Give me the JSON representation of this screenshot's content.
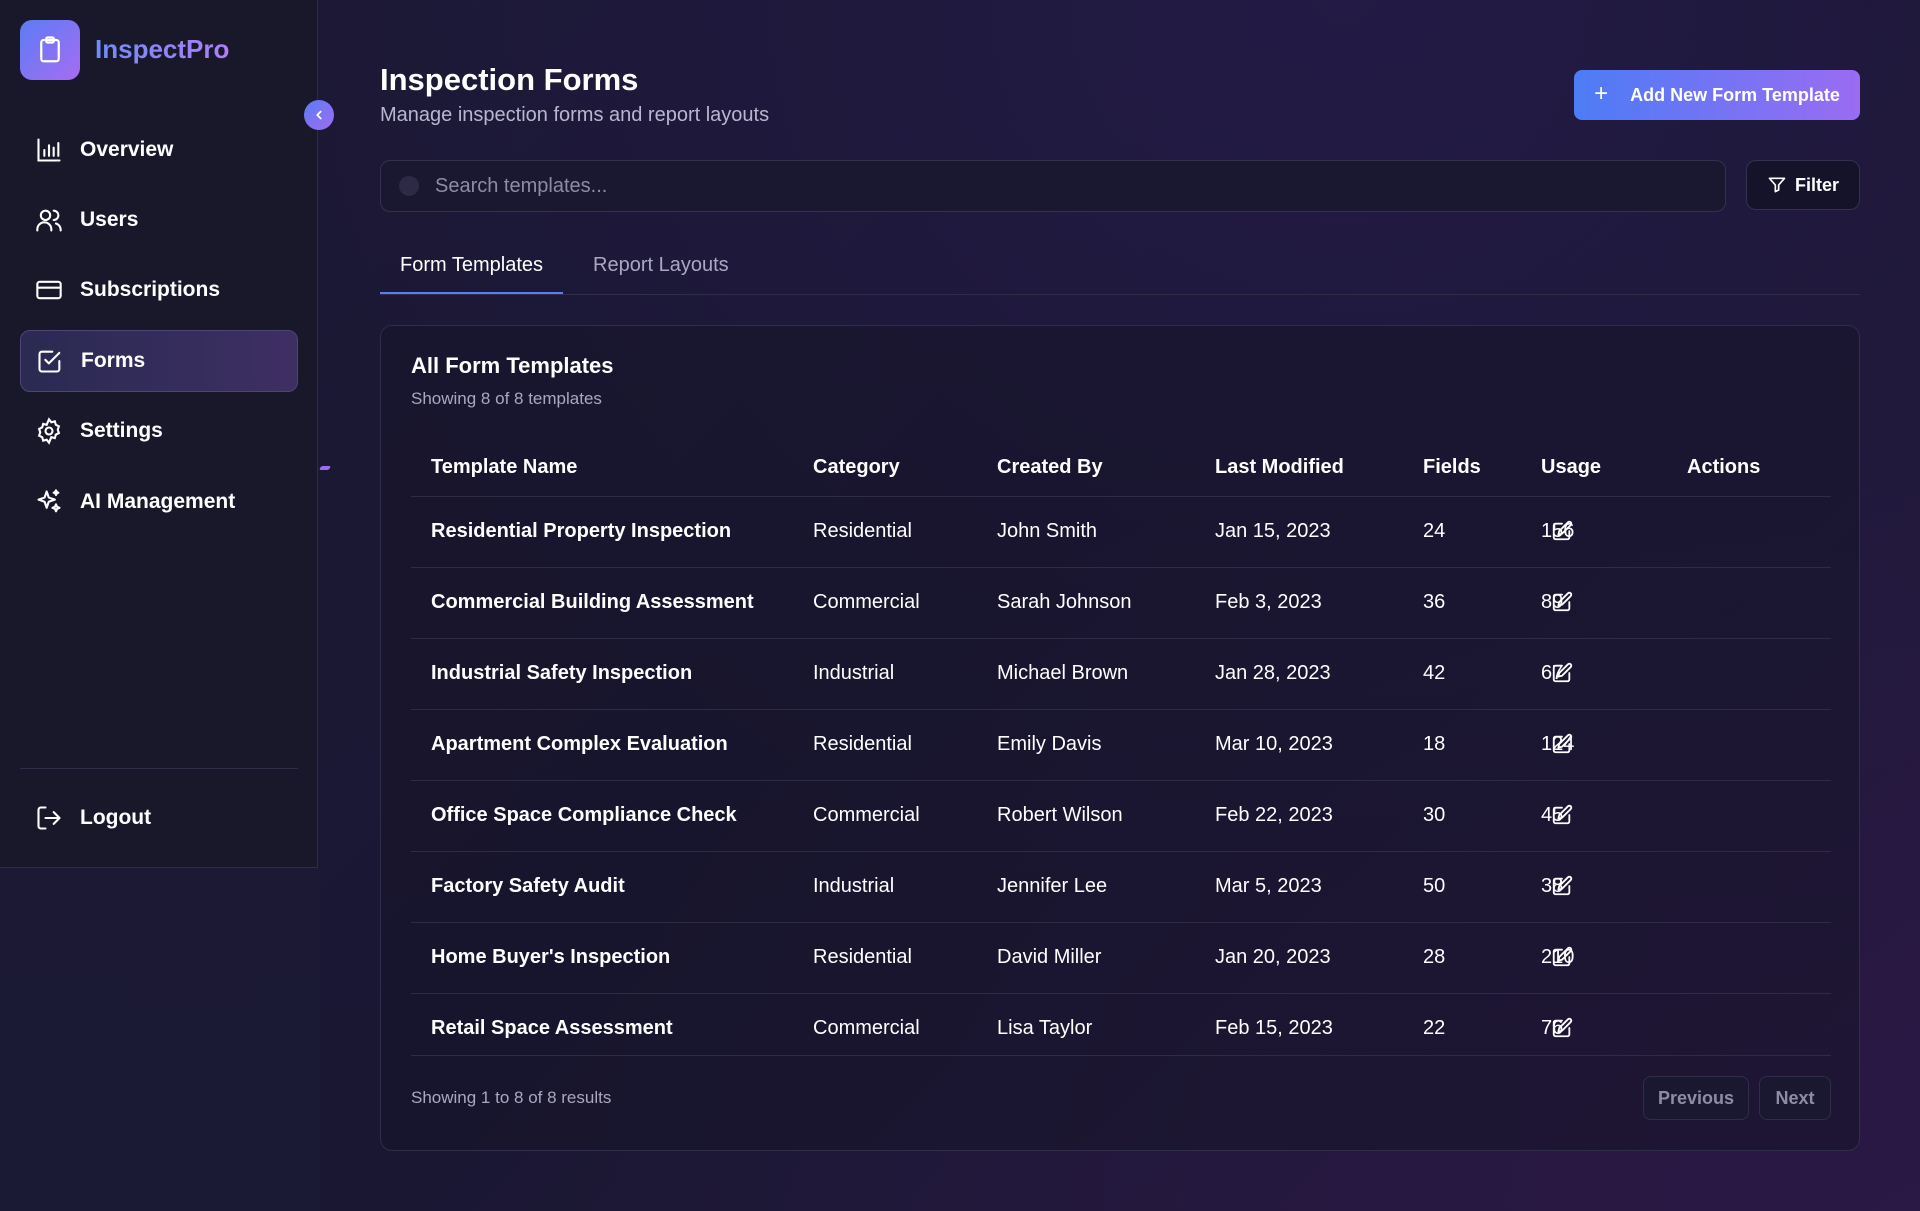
{
  "app": {
    "brand": "InspectPro"
  },
  "sidebar": {
    "items": [
      {
        "label": "Overview",
        "icon": "chart-bar-icon"
      },
      {
        "label": "Users",
        "icon": "users-icon"
      },
      {
        "label": "Subscriptions",
        "icon": "credit-card-icon"
      },
      {
        "label": "Forms",
        "icon": "clipboard-check-icon",
        "active": true
      },
      {
        "label": "Settings",
        "icon": "gear-icon"
      },
      {
        "label": "AI Management",
        "icon": "sparkles-icon"
      }
    ],
    "logout_label": "Logout"
  },
  "header": {
    "title": "Inspection Forms",
    "subtitle": "Manage inspection forms and report layouts",
    "add_button_label": "Add New Form Template"
  },
  "search": {
    "placeholder": "Search templates...",
    "value": ""
  },
  "filter_label": "Filter",
  "tabs": [
    {
      "label": "Form Templates",
      "active": true
    },
    {
      "label": "Report Layouts",
      "active": false
    }
  ],
  "card": {
    "title": "All Form Templates",
    "subtitle": "Showing 8 of 8 templates"
  },
  "table": {
    "columns": [
      "Template Name",
      "Category",
      "Created By",
      "Last Modified",
      "Fields",
      "Usage",
      "Actions"
    ],
    "rows": [
      {
        "name": "Residential Property Inspection",
        "category": "Residential",
        "created_by": "John Smith",
        "modified": "Jan 15, 2023",
        "fields": "24",
        "usage": "156"
      },
      {
        "name": "Commercial Building Assessment",
        "category": "Commercial",
        "created_by": "Sarah Johnson",
        "modified": "Feb 3, 2023",
        "fields": "36",
        "usage": "89"
      },
      {
        "name": "Industrial Safety Inspection",
        "category": "Industrial",
        "created_by": "Michael Brown",
        "modified": "Jan 28, 2023",
        "fields": "42",
        "usage": "67"
      },
      {
        "name": "Apartment Complex Evaluation",
        "category": "Residential",
        "created_by": "Emily Davis",
        "modified": "Mar 10, 2023",
        "fields": "18",
        "usage": "124"
      },
      {
        "name": "Office Space Compliance Check",
        "category": "Commercial",
        "created_by": "Robert Wilson",
        "modified": "Feb 22, 2023",
        "fields": "30",
        "usage": "45"
      },
      {
        "name": "Factory Safety Audit",
        "category": "Industrial",
        "created_by": "Jennifer Lee",
        "modified": "Mar 5, 2023",
        "fields": "50",
        "usage": "38"
      },
      {
        "name": "Home Buyer's Inspection",
        "category": "Residential",
        "created_by": "David Miller",
        "modified": "Jan 20, 2023",
        "fields": "28",
        "usage": "210"
      },
      {
        "name": "Retail Space Assessment",
        "category": "Commercial",
        "created_by": "Lisa Taylor",
        "modified": "Feb 15, 2023",
        "fields": "22",
        "usage": "76"
      }
    ]
  },
  "pagination": {
    "summary": "Showing 1 to 8 of 8 results",
    "previous_label": "Previous",
    "next_label": "Next"
  },
  "colors": {
    "accent_blue": "#5b7cf5",
    "accent_purple": "#9a6cf2",
    "background": "#1c1936",
    "sidebar": "#19182a"
  }
}
